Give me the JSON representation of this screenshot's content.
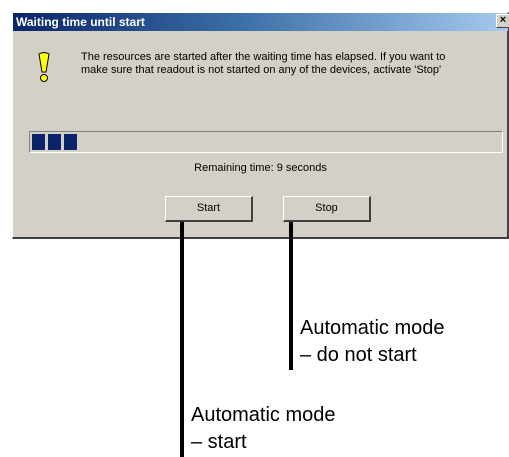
{
  "dialog": {
    "title": "Waiting time until start",
    "close_label": "×",
    "message_line1": "The resources are started after the waiting time has elapsed. If you want to",
    "message_line2": "make sure that readout is not started on any of the devices, activate 'Stop'",
    "progress_blocks": 3,
    "progress_color": "#0a246a",
    "remaining_text": "Remaining time: 9 seconds",
    "start_label": "Start",
    "stop_label": "Stop",
    "icon": "warning-exclamation-icon"
  },
  "callouts": {
    "stop_line1": "Automatic mode",
    "stop_line2": "– do not start",
    "start_line1": "Automatic mode",
    "start_line2": "– start"
  }
}
